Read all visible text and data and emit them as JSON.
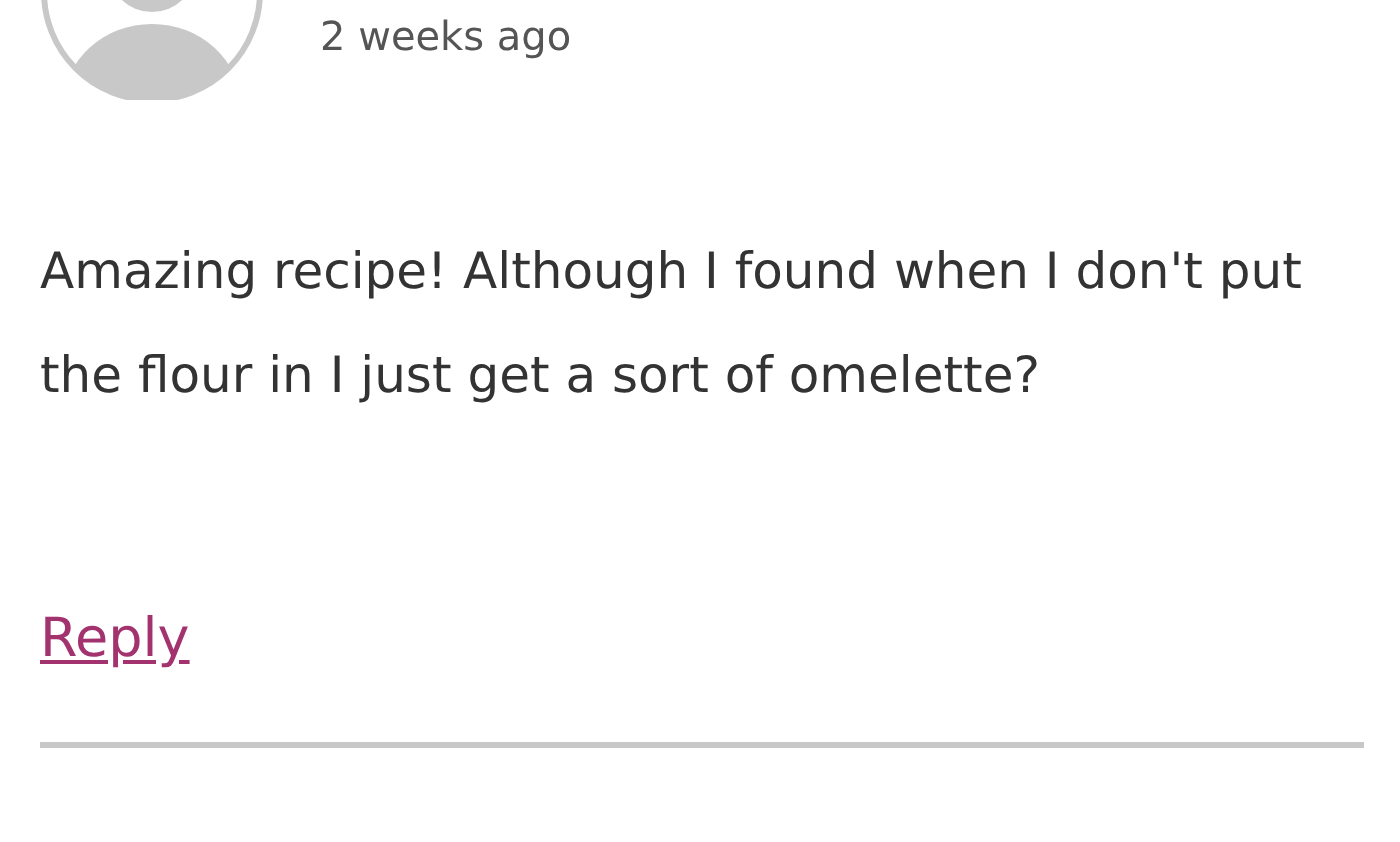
{
  "comment": {
    "time": "2 weeks ago",
    "text": "Amazing recipe! Although I found when I don't put the flour in I just get a sort of omelette?",
    "reply_link": "Reply"
  }
}
